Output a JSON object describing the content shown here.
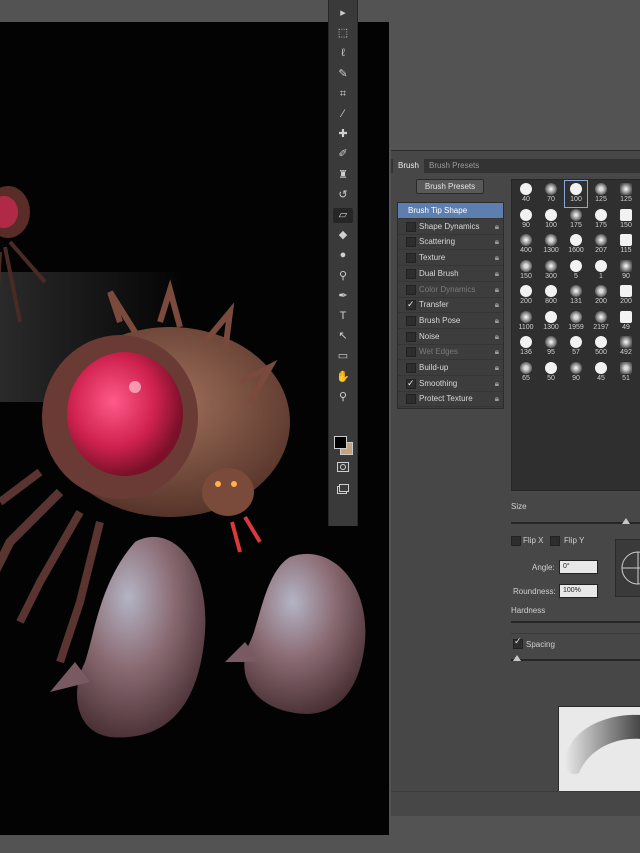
{
  "panel": {
    "tabs": [
      {
        "label": "Brush"
      },
      {
        "label": "Brush Presets"
      }
    ],
    "brush_presets_button": "Brush Presets",
    "options": [
      {
        "label": "Brush Tip Shape",
        "checked": null,
        "dim": false,
        "head": true
      },
      {
        "label": "Shape Dynamics",
        "checked": false,
        "dim": false
      },
      {
        "label": "Scattering",
        "checked": false,
        "dim": false
      },
      {
        "label": "Texture",
        "checked": false,
        "dim": false
      },
      {
        "label": "Dual Brush",
        "checked": false,
        "dim": false
      },
      {
        "label": "Color Dynamics",
        "checked": false,
        "dim": true
      },
      {
        "label": "Transfer",
        "checked": true,
        "dim": false
      },
      {
        "label": "Brush Pose",
        "checked": false,
        "dim": false
      },
      {
        "label": "Noise",
        "checked": false,
        "dim": false
      },
      {
        "label": "Wet Edges",
        "checked": false,
        "dim": true
      },
      {
        "label": "Build-up",
        "checked": false,
        "dim": false
      },
      {
        "label": "Smoothing",
        "checked": true,
        "dim": false
      },
      {
        "label": "Protect Texture",
        "checked": false,
        "dim": false
      }
    ],
    "tip_sizes": [
      "40",
      "70",
      "100",
      "125",
      "125",
      "90",
      "100",
      "175",
      "175",
      "150",
      "400",
      "1300",
      "1600",
      "207",
      "115",
      "150",
      "300",
      "5",
      "1",
      "90",
      "200",
      "800",
      "131",
      "200",
      "200",
      "1100",
      "1300",
      "1959",
      "2197",
      "49",
      "136",
      "95",
      "57",
      "500",
      "492",
      "65",
      "50",
      "90",
      "45",
      "51"
    ],
    "size_label": "Size",
    "flip_x": "Flip X",
    "flip_y": "Flip Y",
    "angle_label": "Angle:",
    "angle_value": "0°",
    "roundness_label": "Roundness:",
    "roundness_value": "100%",
    "hardness_label": "Hardness",
    "spacing_label": "Spacing",
    "spacing_checked": true
  },
  "tools": [
    {
      "name": "move-tool-icon",
      "glyph": "▸"
    },
    {
      "name": "marquee-tool-icon",
      "glyph": "⬚"
    },
    {
      "name": "lasso-tool-icon",
      "glyph": "ℓ"
    },
    {
      "name": "quick-select-tool-icon",
      "glyph": "✎"
    },
    {
      "name": "crop-tool-icon",
      "glyph": "⌗"
    },
    {
      "name": "eyedropper-tool-icon",
      "glyph": "∕"
    },
    {
      "name": "healing-brush-tool-icon",
      "glyph": "✚"
    },
    {
      "name": "brush-tool-icon",
      "glyph": "✐"
    },
    {
      "name": "clone-stamp-tool-icon",
      "glyph": "♜"
    },
    {
      "name": "history-brush-tool-icon",
      "glyph": "↺"
    },
    {
      "name": "eraser-tool-icon",
      "glyph": "▱"
    },
    {
      "name": "paint-bucket-tool-icon",
      "glyph": "◆"
    },
    {
      "name": "blur-tool-icon",
      "glyph": "●"
    },
    {
      "name": "dodge-tool-icon",
      "glyph": "⚲"
    },
    {
      "name": "pen-tool-icon",
      "glyph": "✒"
    },
    {
      "name": "type-tool-icon",
      "glyph": "T"
    },
    {
      "name": "path-select-tool-icon",
      "glyph": "↖"
    },
    {
      "name": "shape-tool-icon",
      "glyph": "▭"
    },
    {
      "name": "hand-tool-icon",
      "glyph": "✋"
    },
    {
      "name": "zoom-tool-icon",
      "glyph": "⚲"
    }
  ],
  "colors": {
    "foreground": "#000000",
    "background": "#c8a27a",
    "accent": "#5d7fb0"
  }
}
